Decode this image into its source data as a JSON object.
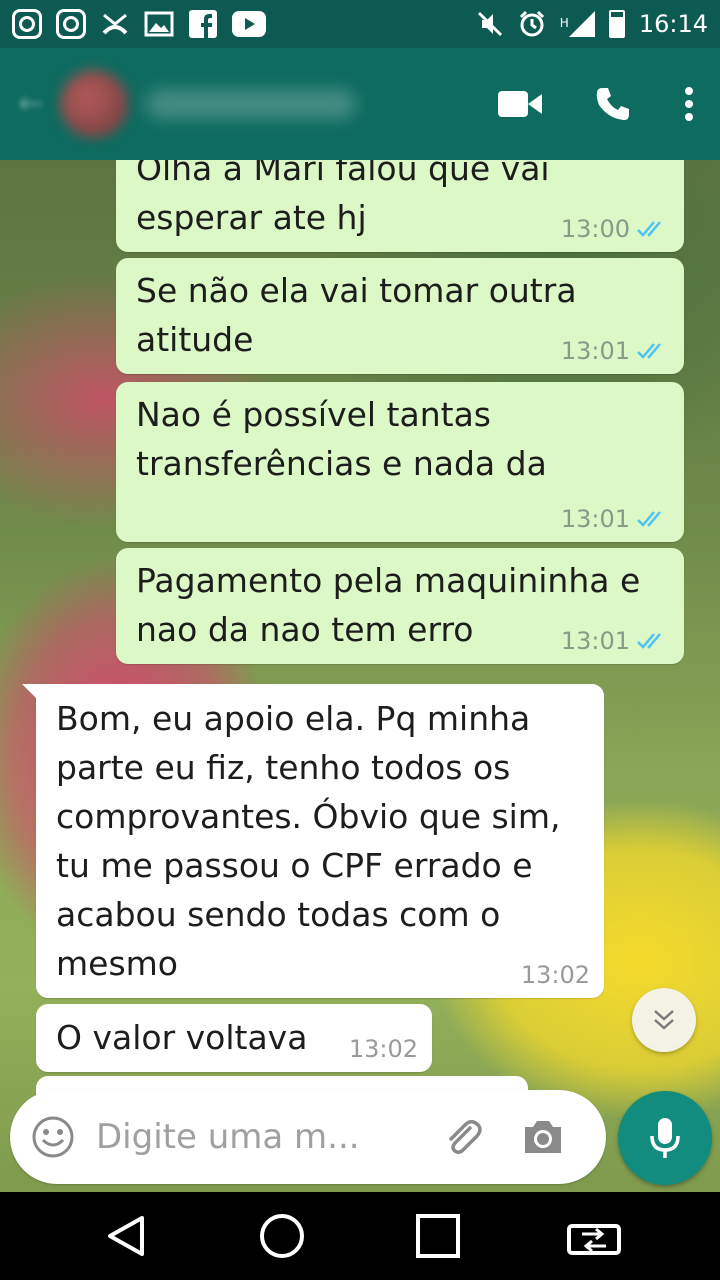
{
  "status_bar": {
    "time": "16:14",
    "network": "H",
    "left_icons": [
      "instagram-icon",
      "instagram-icon",
      "missed-call-icon",
      "gallery-icon",
      "facebook-icon",
      "youtube-icon"
    ],
    "right_icons": [
      "mute-icon",
      "alarm-icon",
      "signal-icon",
      "battery-icon"
    ]
  },
  "header": {
    "contact_name": "",
    "actions": [
      "video-call-icon",
      "voice-call-icon",
      "more-options-icon"
    ]
  },
  "messages": [
    {
      "direction": "out",
      "text_top": "Olha a Mari falou que vai",
      "text": "esperar ate hj",
      "time": "13:00",
      "status": "read"
    },
    {
      "direction": "out",
      "text": "Se não ela vai tomar outra atitude",
      "time": "13:01",
      "status": "read"
    },
    {
      "direction": "out",
      "text": "Nao é possível tantas transferências e nada da",
      "time": "13:01",
      "status": "read"
    },
    {
      "direction": "out",
      "text": "Pagamento pela maquininha e nao da nao tem erro",
      "time": "13:01",
      "status": "read"
    },
    {
      "direction": "in",
      "text": "Bom, eu apoio ela. Pq minha parte eu fiz, tenho todos os comprovantes. Óbvio que sim, tu me passou o CPF errado e acabou sendo todas com o mesmo",
      "time": "13:02"
    },
    {
      "direction": "in",
      "text": "O valor voltava",
      "time": "13:02"
    }
  ],
  "composer": {
    "placeholder": "Digite uma m..."
  },
  "colors": {
    "header": "#0e6b60",
    "status_bar": "#0c5a51",
    "outgoing_bubble": "#dcf8c6",
    "incoming_bubble": "#ffffff",
    "read_check": "#4fc3f7",
    "mic_button": "#128c7e"
  },
  "nav_bar": [
    "back-icon",
    "home-icon",
    "recents-icon",
    "rotate-icon"
  ]
}
